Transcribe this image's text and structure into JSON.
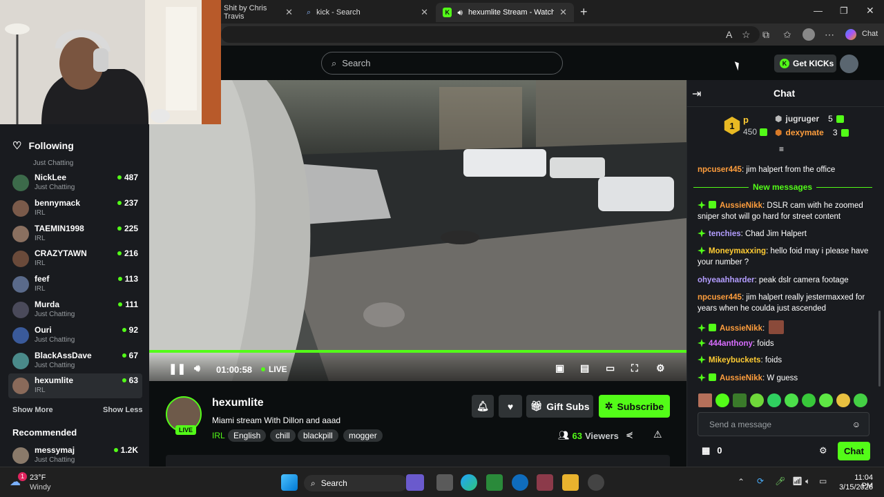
{
  "browser": {
    "tabs": [
      {
        "label": "Shit by Chris Travis"
      },
      {
        "label": "kick - Search"
      },
      {
        "label": "hexumlite Stream - Watch Live"
      }
    ],
    "copilot_label": "Chat"
  },
  "topnav": {
    "search_placeholder": "Search",
    "get_kicks_label": "Get KICKs"
  },
  "sidebar": {
    "following_label": "Following",
    "partial_category": "Just Chatting",
    "channels": [
      {
        "name": "NickLee",
        "category": "Just Chatting",
        "viewers": "487"
      },
      {
        "name": "bennymack",
        "category": "IRL",
        "viewers": "237"
      },
      {
        "name": "TAEMIN1998",
        "category": "IRL",
        "viewers": "225"
      },
      {
        "name": "CRAZYTAWN",
        "category": "IRL",
        "viewers": "216"
      },
      {
        "name": "feef",
        "category": "IRL",
        "viewers": "113"
      },
      {
        "name": "Murda",
        "category": "Just Chatting",
        "viewers": "111"
      },
      {
        "name": "Ouri",
        "category": "Just Chatting",
        "viewers": "92"
      },
      {
        "name": "BlackAssDave",
        "category": "Just Chatting",
        "viewers": "67"
      },
      {
        "name": "hexumlite",
        "category": "IRL",
        "viewers": "63"
      }
    ],
    "show_more": "Show More",
    "show_less": "Show Less",
    "recommended_label": "Recommended",
    "recommended": [
      {
        "name": "messymaj",
        "category": "Just Chatting",
        "viewers": "1.2K"
      }
    ]
  },
  "player": {
    "time": "01:00:58",
    "live_label": "LIVE"
  },
  "stream": {
    "streamer": "hexumlite",
    "live_badge": "LIVE",
    "title": "Miami stream With Dillon and aaad",
    "category": "IRL",
    "tags": [
      "English",
      "chill",
      "blackpill",
      "mogger"
    ],
    "gift_subs": "Gift Subs",
    "subscribe": "Subscribe",
    "viewers_count": "63",
    "viewers_label": "Viewers"
  },
  "chat": {
    "title": "Chat",
    "leaderboard": {
      "top_name": "p",
      "top_rank": "1",
      "top_count": "450",
      "second_name": "jugruger",
      "second_count": "5",
      "third_name": "dexymate",
      "third_count": "3"
    },
    "new_messages_label": "New messages",
    "messages": [
      {
        "user": "npcuser445",
        "text": ": jim halpert from the office",
        "color": "#ff9e3d"
      },
      {
        "user": "AussieNikk",
        "text": ": DSLR cam with he zoomed sniper shot will go hard for street content",
        "color": "#ff9e3d"
      },
      {
        "user": "tenchies",
        "text": ": Chad Jim Halpert",
        "color": "#b39dff"
      },
      {
        "user": "Moneymaxxing",
        "text": ": hello foid may i please have your number ?",
        "color": "#ffcc33"
      },
      {
        "user": "ohyeaahharder",
        "text": ": peak dslr camera footage",
        "color": "#b39dff"
      },
      {
        "user": "npcuser445",
        "text": ": jim halpert really jestermaxxed for years when he coulda just ascended",
        "color": "#ff9e3d"
      },
      {
        "user": "AussieNikk",
        "text": ":",
        "color": "#ff9e3d"
      },
      {
        "user": "444anthony",
        "text": ": foids",
        "color": "#d86dff"
      },
      {
        "user": "Mikeybuckets",
        "text": ": foids",
        "color": "#ffcc33"
      },
      {
        "user": "AussieNikk",
        "text": ": W guess",
        "color": "#ff9e3d"
      }
    ],
    "input_placeholder": "Send a message",
    "kicks_count": "0",
    "send_label": "Chat"
  },
  "taskbar": {
    "temp": "23°F",
    "weather": "Windy",
    "weather_badge": "1",
    "search_label": "Search",
    "time": "11:04 PM",
    "date": "3/15/2026"
  },
  "colors": {
    "accent": "#53fc18",
    "bg": "#0b0e0f",
    "panel": "#191b1f"
  }
}
